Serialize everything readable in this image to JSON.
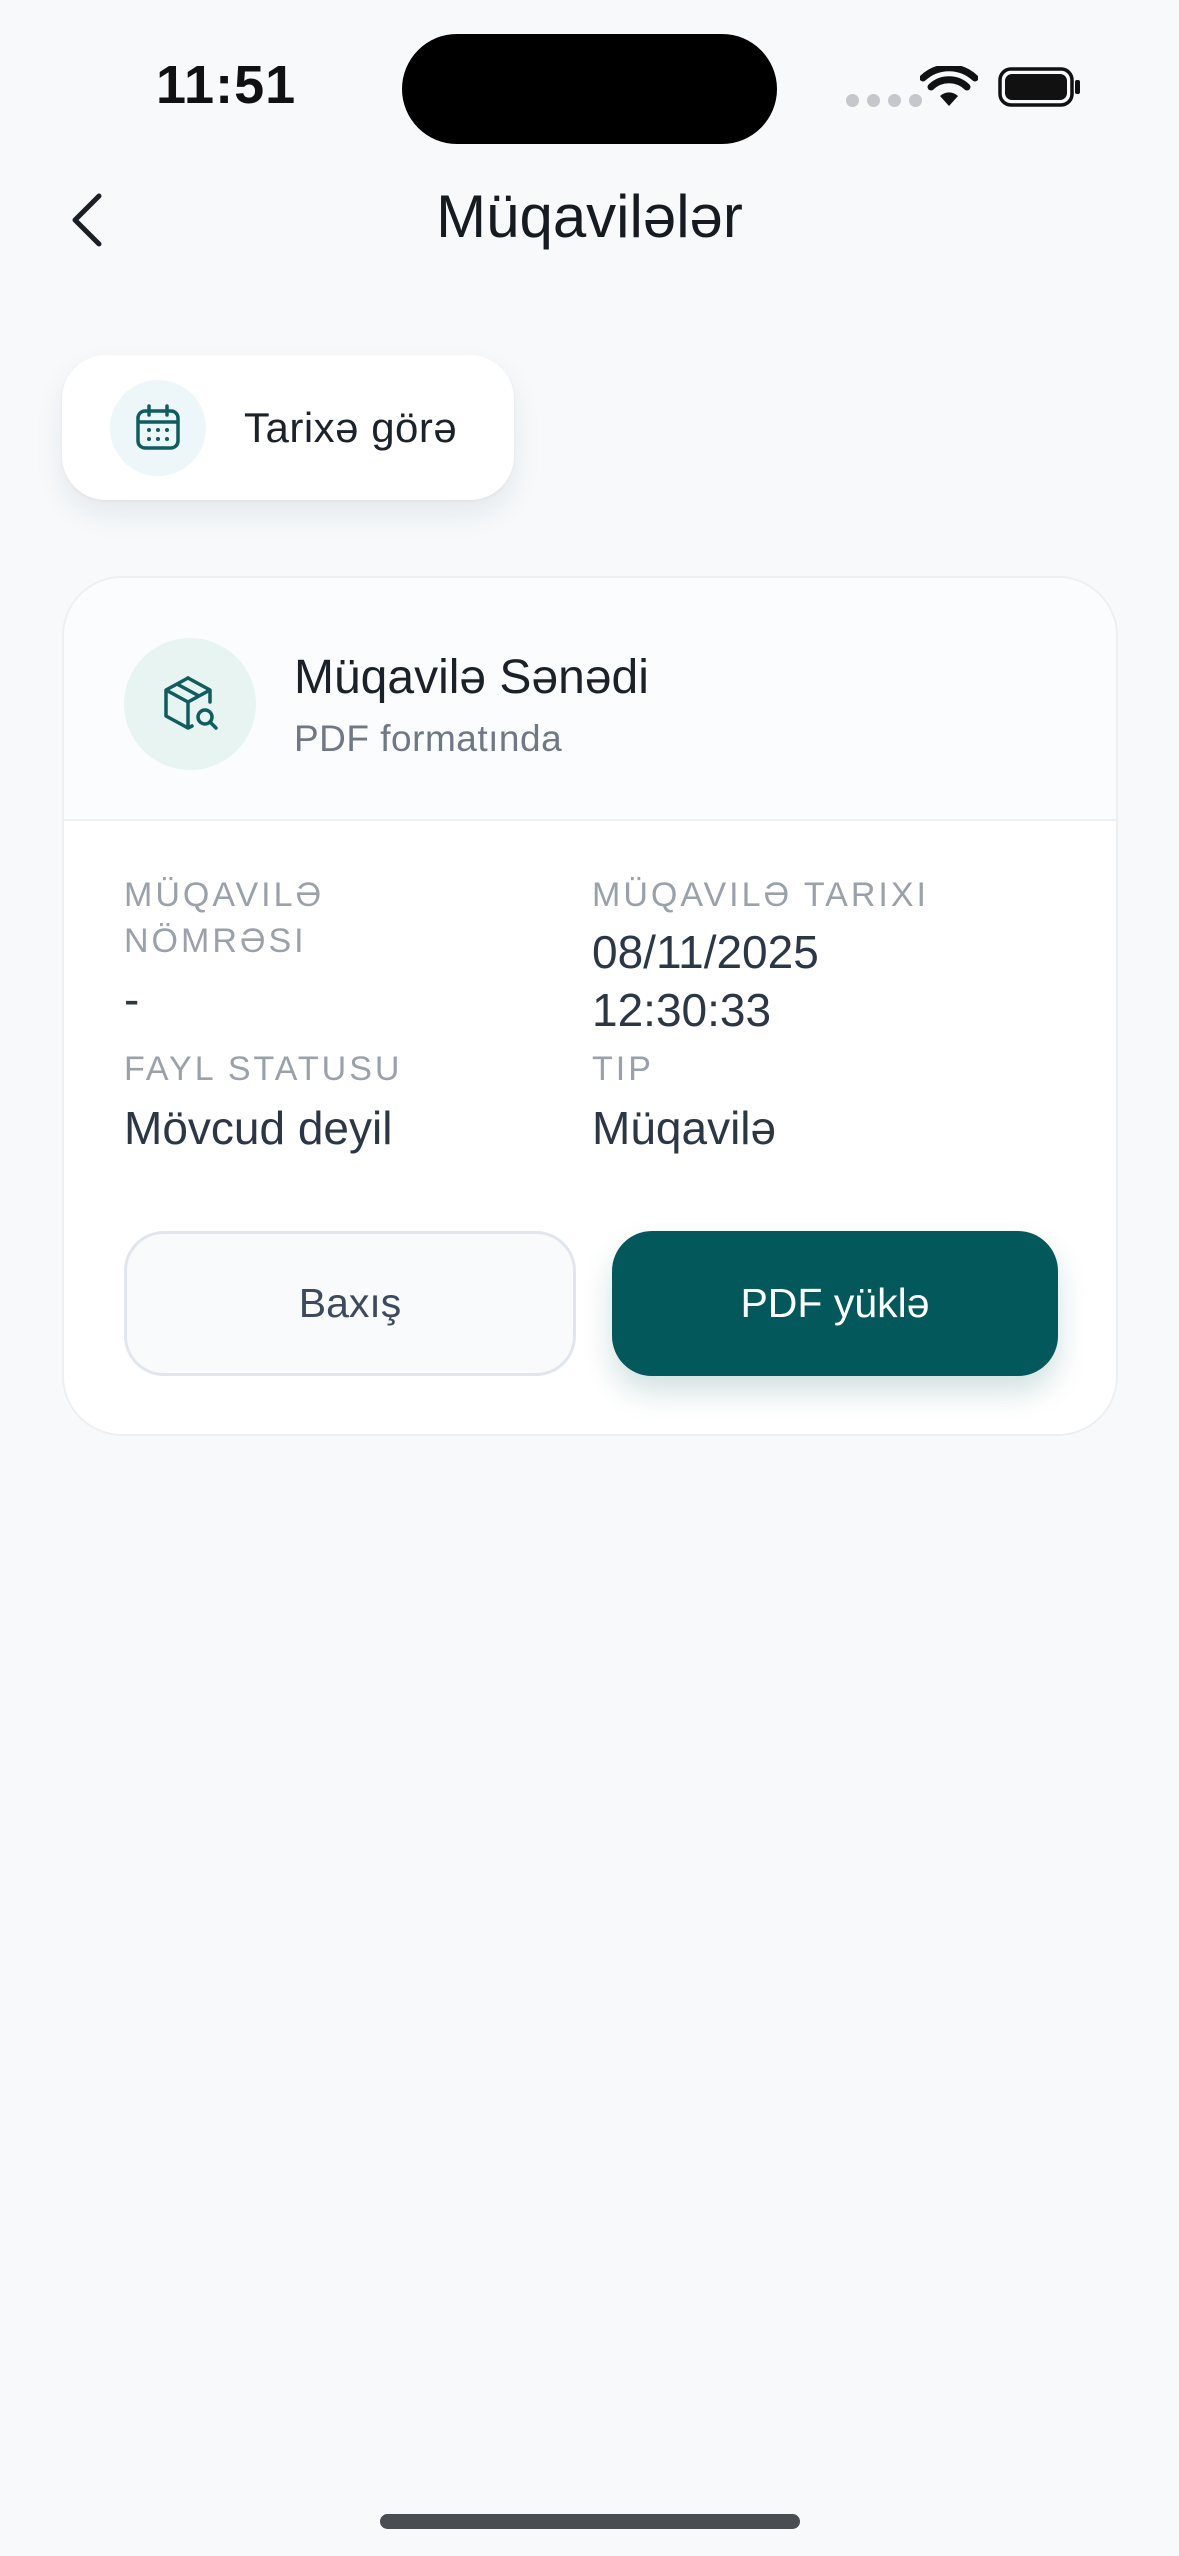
{
  "status_bar": {
    "time": "11:51"
  },
  "header": {
    "title": "Müqavilələr",
    "back_icon": "chevron-left-icon"
  },
  "filter": {
    "label": "Tarixə görə",
    "icon": "calendar-icon"
  },
  "contract_card": {
    "icon": "package-search-icon",
    "title": "Müqavilə Sənədi",
    "subtitle": "PDF formatında",
    "fields": {
      "number_label": "MÜQAVILƏ NÖMRƏSI",
      "number_value": "-",
      "date_label": "MÜQAVILƏ TARIXI",
      "date_value_date": "08/11/2025",
      "date_value_time": "12:30:33",
      "status_label": "FAYL STATUSU",
      "status_value": "Mövcud deyil",
      "type_label": "TIP",
      "type_value": "Müqavilə"
    },
    "buttons": {
      "view_label": "Baxış",
      "download_label": "PDF yüklə"
    }
  },
  "colors": {
    "primary": "#02585a",
    "background": "#f7f9fb",
    "card": "#ffffff"
  }
}
